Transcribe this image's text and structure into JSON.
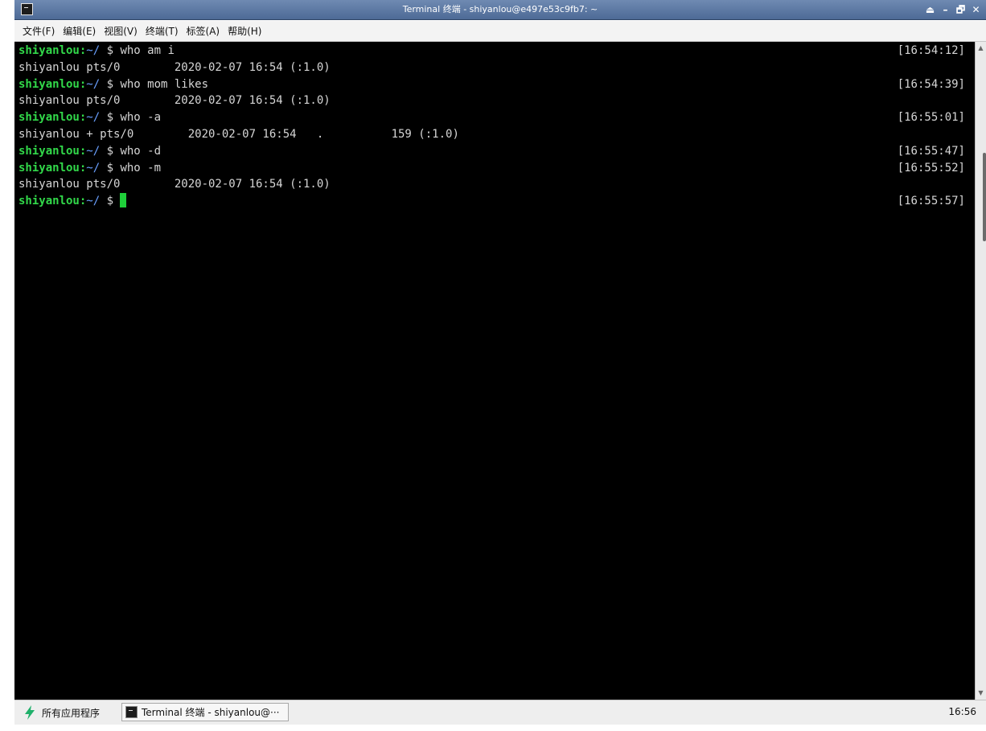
{
  "window": {
    "title": "Terminal 终端 - shiyanlou@e497e53c9fb7: ~",
    "buttons": [
      "⏏",
      "–",
      "🗗",
      "✕"
    ]
  },
  "menu": [
    "文件(F)",
    "编辑(E)",
    "视图(V)",
    "终端(T)",
    "标签(A)",
    "帮助(H)"
  ],
  "terminal": {
    "prompt_user": "shiyanlou:",
    "prompt_path": "~/",
    "prompt_symbol": " $ ",
    "lines": [
      {
        "type": "prompt",
        "cmd": "who am i",
        "time": "[16:54:12]"
      },
      {
        "type": "output",
        "text": "shiyanlou pts/0        2020-02-07 16:54 (:1.0)"
      },
      {
        "type": "prompt",
        "cmd": "who mom likes",
        "time": "[16:54:39]"
      },
      {
        "type": "output",
        "text": "shiyanlou pts/0        2020-02-07 16:54 (:1.0)"
      },
      {
        "type": "prompt",
        "cmd": "who -a",
        "time": "[16:55:01]"
      },
      {
        "type": "output",
        "text": "shiyanlou + pts/0        2020-02-07 16:54   .          159 (:1.0)"
      },
      {
        "type": "prompt",
        "cmd": "who -d",
        "time": "[16:55:47]"
      },
      {
        "type": "prompt",
        "cmd": "who -m",
        "time": "[16:55:52]"
      },
      {
        "type": "output",
        "text": "shiyanlou pts/0        2020-02-07 16:54 (:1.0)"
      },
      {
        "type": "prompt",
        "cmd": "",
        "time": "[16:55:57]",
        "cursor": true
      }
    ],
    "colors": {
      "background": "#000000",
      "text": "#d6d6d6",
      "user": "#32d94a",
      "path": "#6aa0ff",
      "cursor": "#1fcf3a"
    }
  },
  "taskbar": {
    "apps_label": "所有应用程序",
    "task_label": "Terminal 终端 - shiyanlou@···",
    "clock": "16:56"
  }
}
